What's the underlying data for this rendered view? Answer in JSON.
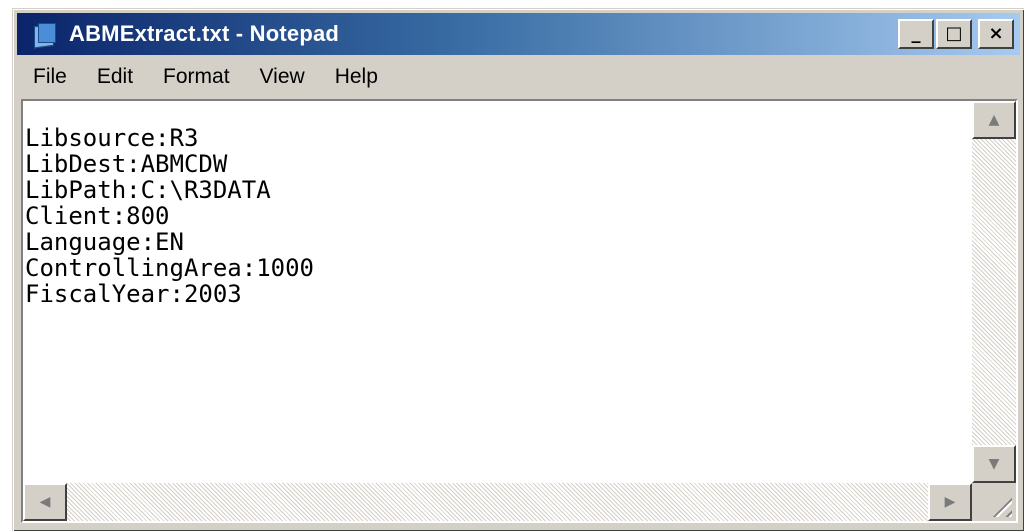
{
  "window": {
    "title": "ABMExtract.txt - Notepad",
    "icon": "notepad-icon"
  },
  "titlebar_buttons": {
    "minimize": "_",
    "maximize": "□",
    "close": "×"
  },
  "menu": {
    "items": [
      "File",
      "Edit",
      "Format",
      "View",
      "Help"
    ]
  },
  "editor": {
    "lines": [
      "Libsource:R3",
      "LibDest:ABMCDW",
      "LibPath:C:\\R3DATA",
      "Client:800",
      "Language:EN",
      "ControllingArea:1000",
      "FiscalYear:2003"
    ]
  },
  "scrollbars": {
    "up": "▲",
    "down": "▼",
    "left": "◀",
    "right": "▶"
  }
}
